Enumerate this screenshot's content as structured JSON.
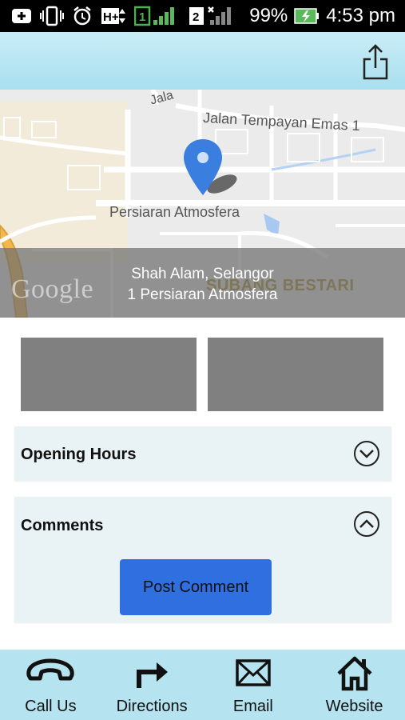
{
  "status_bar": {
    "battery": "99%",
    "time": "4:53 pm",
    "sim1": "1",
    "sim2": "2",
    "network": "H+"
  },
  "map": {
    "road_label_1": "Jalan Tempayan Emas 1",
    "road_label_2": "Persiaran Atmosfera",
    "road_label_top": "Jala",
    "area_label": "SUBANG BESTARI",
    "google_logo": "Google",
    "address_line_1": "Shah Alam, Selangor",
    "address_line_2": "1 Persiaran Atmosfera"
  },
  "panels": {
    "opening_hours": {
      "title": "Opening Hours",
      "icon": "chevron-down-circle-icon"
    },
    "comments": {
      "title": "Comments",
      "icon": "chevron-up-circle-icon",
      "button": "Post Comment"
    }
  },
  "bottom_nav": [
    {
      "label": "Call Us",
      "icon": "phone-icon"
    },
    {
      "label": "Directions",
      "icon": "directions-arrow-icon"
    },
    {
      "label": "Email",
      "icon": "envelope-icon"
    },
    {
      "label": "Website",
      "icon": "home-icon"
    }
  ],
  "colors": {
    "header": "#b9e5f1",
    "panel_bg": "#e9f3f6",
    "button": "#2f6fdf",
    "pin": "#3a7fe0",
    "gray_block": "#808080"
  }
}
